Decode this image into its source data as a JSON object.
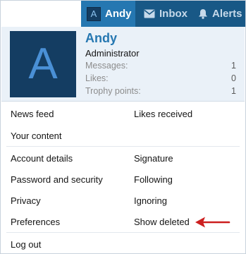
{
  "navbar": {
    "account": {
      "avatar_letter": "A",
      "label": "Andy"
    },
    "inbox": {
      "label": "Inbox",
      "icon": "envelope-icon"
    },
    "alerts": {
      "label": "Alerts",
      "icon": "bell-icon"
    }
  },
  "profile": {
    "avatar_letter": "A",
    "username": "Andy",
    "title": "Administrator",
    "stats": [
      {
        "label": "Messages:",
        "value": "1"
      },
      {
        "label": "Likes:",
        "value": "0"
      },
      {
        "label": "Trophy points:",
        "value": "1"
      }
    ]
  },
  "menu": {
    "news_feed": "News feed",
    "likes_received": "Likes received",
    "your_content": "Your content",
    "account_details": "Account details",
    "signature": "Signature",
    "password_security": "Password and security",
    "following": "Following",
    "privacy": "Privacy",
    "ignoring": "Ignoring",
    "preferences": "Preferences",
    "show_deleted": "Show deleted",
    "log_out": "Log out"
  },
  "colors": {
    "accent": "#2577b1",
    "nav_dark": "#185886",
    "profile_bg": "#eaf1f8",
    "avatar_bg": "#143d62",
    "arrow": "#cc1f1f"
  }
}
